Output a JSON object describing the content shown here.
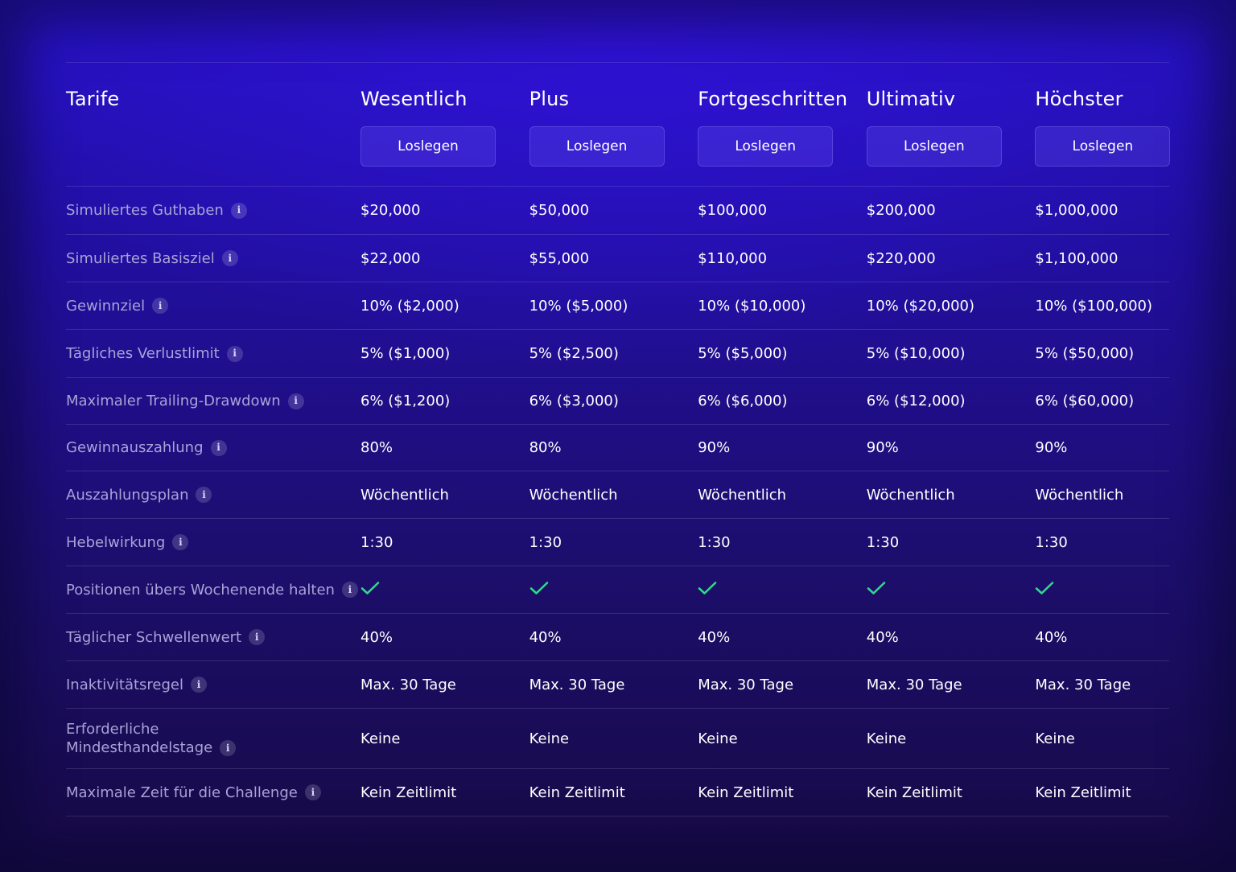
{
  "table": {
    "header_label": "Tarife",
    "plans": [
      {
        "name": "Wesentlich",
        "cta": "Loslegen"
      },
      {
        "name": "Plus",
        "cta": "Loslegen"
      },
      {
        "name": "Fortgeschritten",
        "cta": "Loslegen"
      },
      {
        "name": "Ultimativ",
        "cta": "Loslegen"
      },
      {
        "name": "Höchster",
        "cta": "Loslegen"
      }
    ],
    "rows": [
      {
        "label": "Simuliertes Guthaben",
        "values": [
          "$20,000",
          "$50,000",
          "$100,000",
          "$200,000",
          "$1,000,000"
        ]
      },
      {
        "label": "Simuliertes Basisziel",
        "values": [
          "$22,000",
          "$55,000",
          "$110,000",
          "$220,000",
          "$1,100,000"
        ]
      },
      {
        "label": "Gewinnziel",
        "values": [
          "10% ($2,000)",
          "10% ($5,000)",
          "10% ($10,000)",
          "10% ($20,000)",
          "10% ($100,000)"
        ]
      },
      {
        "label": "Tägliches Verlustlimit",
        "values": [
          "5% ($1,000)",
          "5% ($2,500)",
          "5% ($5,000)",
          "5% ($10,000)",
          "5% ($50,000)"
        ]
      },
      {
        "label": "Maximaler Trailing-Drawdown",
        "values": [
          "6% ($1,200)",
          "6% ($3,000)",
          "6% ($6,000)",
          "6% ($12,000)",
          "6% ($60,000)"
        ]
      },
      {
        "label": "Gewinnauszahlung",
        "values": [
          "80%",
          "80%",
          "90%",
          "90%",
          "90%"
        ]
      },
      {
        "label": "Auszahlungsplan",
        "values": [
          "Wöchentlich",
          "Wöchentlich",
          "Wöchentlich",
          "Wöchentlich",
          "Wöchentlich"
        ]
      },
      {
        "label": "Hebelwirkung",
        "values": [
          "1:30",
          "1:30",
          "1:30",
          "1:30",
          "1:30"
        ]
      },
      {
        "label": "Positionen übers Wochenende halten",
        "check": true
      },
      {
        "label": "Täglicher Schwellenwert",
        "values": [
          "40%",
          "40%",
          "40%",
          "40%",
          "40%"
        ]
      },
      {
        "label": "Inaktivitätsregel",
        "values": [
          "Max. 30 Tage",
          "Max. 30 Tage",
          "Max. 30 Tage",
          "Max. 30 Tage",
          "Max. 30 Tage"
        ]
      },
      {
        "label_line1": "Erforderliche",
        "label_line2": "Mindesthandelstage",
        "values": [
          "Keine",
          "Keine",
          "Keine",
          "Keine",
          "Keine"
        ]
      },
      {
        "label": "Maximale Zeit für die Challenge",
        "values": [
          "Kein Zeitlimit",
          "Kein Zeitlimit",
          "Kein Zeitlimit",
          "Kein Zeitlimit",
          "Kein Zeitlimit"
        ]
      }
    ],
    "info_icon_glyph": "i",
    "icons": {
      "info": "info-icon",
      "check": "checkmark-icon"
    },
    "colors": {
      "check": "#2fd98a",
      "label_text": "#a9a3d8",
      "button_bg": "#4a3fbf"
    }
  }
}
